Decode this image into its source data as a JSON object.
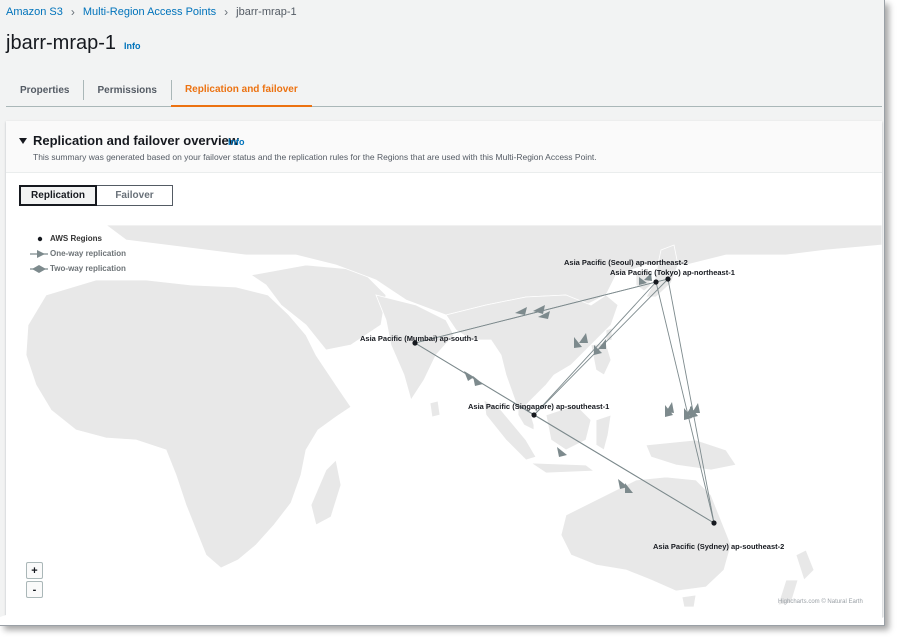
{
  "breadcrumb": [
    "Amazon S3",
    "Multi-Region Access Points",
    "jbarr-mrap-1"
  ],
  "page": {
    "title": "jbarr-mrap-1",
    "info": "Info"
  },
  "tabs": [
    {
      "label": "Properties",
      "active": false
    },
    {
      "label": "Permissions",
      "active": false
    },
    {
      "label": "Replication and failover",
      "active": true
    }
  ],
  "panel": {
    "title": "Replication and failover overview",
    "info": "Info",
    "description": "This summary was generated based on your failover status and the replication rules for the Regions that are used with this Multi-Region Access Point."
  },
  "segmented": {
    "options": [
      "Replication",
      "Failover"
    ],
    "selected": "Replication"
  },
  "legend": {
    "regions": "AWS Regions",
    "one_way": "One-way replication",
    "two_way": "Two-way replication"
  },
  "regions": [
    {
      "id": "mumbai",
      "label": "Asia Pacific (Mumbai) ap-south-1"
    },
    {
      "id": "seoul",
      "label": "Asia Pacific (Seoul) ap-northeast-2"
    },
    {
      "id": "tokyo",
      "label": "Asia Pacific (Tokyo) ap-northeast-1"
    },
    {
      "id": "singapore",
      "label": "Asia Pacific (Singapore) ap-southeast-1"
    },
    {
      "id": "sydney",
      "label": "Asia Pacific (Sydney) ap-southeast-2"
    }
  ],
  "zoom": {
    "in": "+",
    "out": "-"
  },
  "credit": "Highcharts.com © Natural Earth",
  "colors": {
    "accent": "#ec7211",
    "link": "#0073bb",
    "route": "#7d8a8d",
    "land": "#e8e8e8"
  }
}
